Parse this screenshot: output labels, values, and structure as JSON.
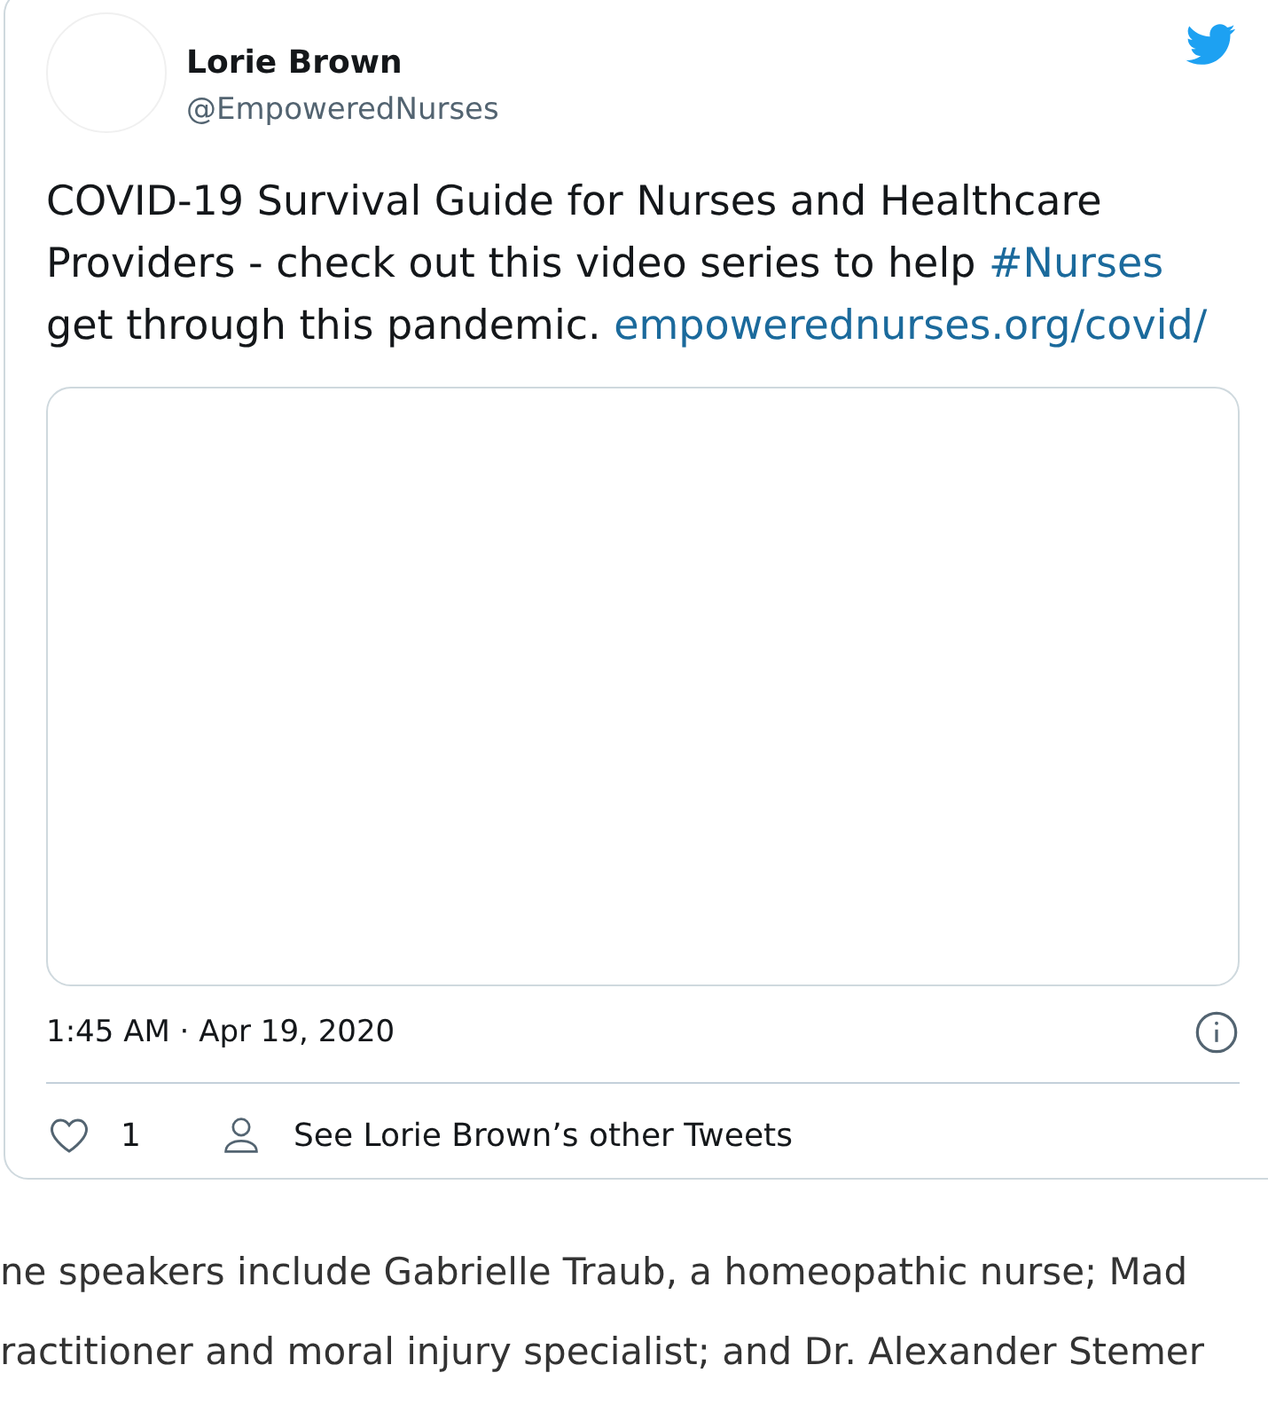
{
  "tweet": {
    "author": {
      "name": "Lorie Brown",
      "handle": "@EmpoweredNurses"
    },
    "text_parts": [
      {
        "kind": "text",
        "text": "COVID-19 Survival Guide for Nurses and Healthcare Providers - check out this video series to help "
      },
      {
        "kind": "link",
        "text": "#Nurses"
      },
      {
        "kind": "text",
        "text": " get through this pandemic. "
      },
      {
        "kind": "link",
        "text": "empowerednurses.org/covid/"
      }
    ],
    "timestamp": "1:45 AM · Apr 19, 2020",
    "likes": "1",
    "profile_link": "See Lorie Brown’s other Tweets"
  },
  "article": {
    "lines": [
      "ne speakers include Gabrielle Traub, a homeopathic nurse; Mad",
      "ractitioner and moral injury specialist; and Dr. Alexander Stemer"
    ]
  }
}
